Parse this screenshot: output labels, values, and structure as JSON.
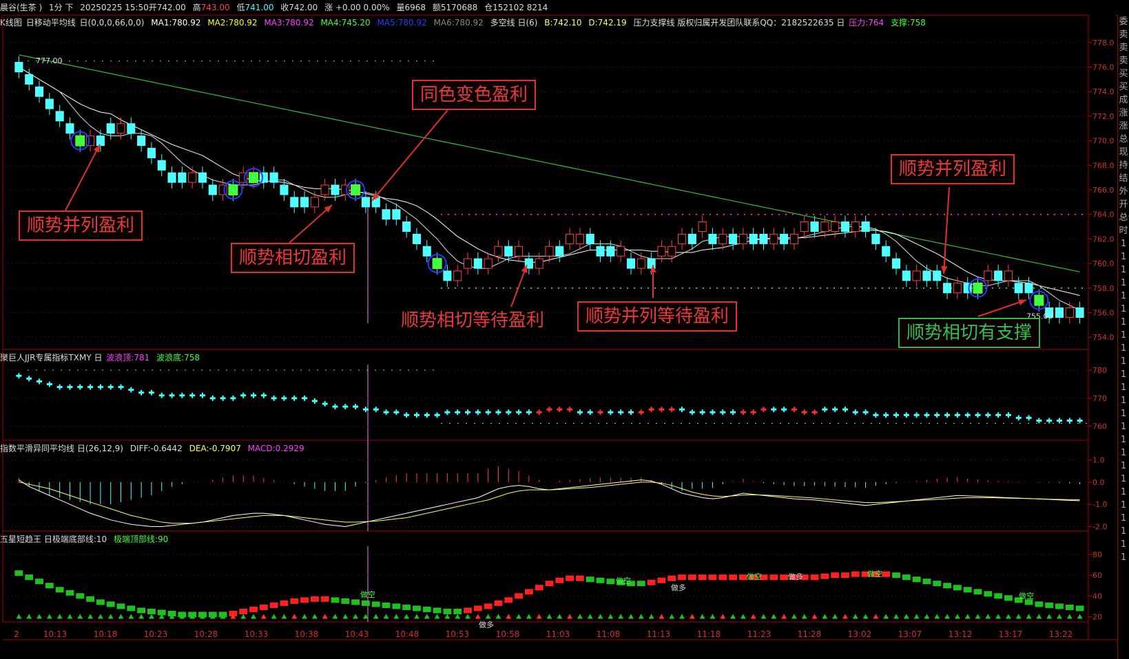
{
  "header": {
    "instrument": "晨谷(生茶 )",
    "period": "1分 下",
    "date": "20250225 15:50",
    "open_label": "开742.00",
    "high_label": "高",
    "high": "743.00",
    "low_label": "低",
    "low": "741.00",
    "close_label": "收742.00",
    "change_label": "涨 +0.00 0.00%",
    "volume": "量6968",
    "amount": "额5170688",
    "position": "仓152102 8214"
  },
  "main_legend": {
    "name": "K线图",
    "ma_name": "日移动平均线",
    "ma_params": "日(0,0,0,66,0,0)",
    "ma1": "MA1:780.92",
    "ma2": "MA2:780.92",
    "ma3": "MA3:780.92",
    "ma4": "MA4:745.20",
    "ma5": "MA5:780.92",
    "ma6": "MA6:780.92",
    "dk": "多空线 日(6)",
    "b": "B:742.10",
    "d": "D:742.19",
    "pressure_name": "压力支撑线 版权归属开发团队联系QQ：2182522635 日",
    "pressure": "压力:764",
    "support": "支撑:758",
    "colors": {
      "ma1": "#ffffff",
      "ma2": "#ffff00",
      "ma3": "#ff00ff",
      "ma4": "#00ff00",
      "ma5": "#2040ff",
      "ma6": "#888888"
    }
  },
  "annotations": [
    {
      "text": "同色变色盈利",
      "style": "red"
    },
    {
      "text": "顺势并列盈利",
      "style": "red"
    },
    {
      "text": "顺势相切盈利",
      "style": "red"
    },
    {
      "text": "顺势相切等待盈利",
      "style": "red"
    },
    {
      "text": "顺势并列等待盈利",
      "style": "red"
    },
    {
      "text": "顺势并列盈利",
      "style": "red"
    },
    {
      "text": "顺势相切有支撑",
      "style": "green"
    }
  ],
  "price_labels": {
    "high_marker": "777.00",
    "low_marker": "755.00"
  },
  "panel2_legend": {
    "name": "聚巨人JJR专属指标TXMY 日",
    "top": "波浪顶:781",
    "bottom": "波浪底:758"
  },
  "panel3_legend": {
    "name": "指数平滑异同平均线 日(26,12,9)",
    "diff": "DIFF:-0.6442",
    "dea": "DEA:-0.7907",
    "macd": "MACD:0.2929"
  },
  "panel4_legend": {
    "name": "五星短趋王 日极端底部线:10",
    "top": "极端顶部线:90"
  },
  "panel4_labels": [
    "做空",
    "做多",
    "做空",
    "做多",
    "做空",
    "做多",
    "做空",
    "做空"
  ],
  "right_column_text": [
    "委",
    "卖",
    "卖",
    "卖",
    "买",
    "买",
    "成",
    "涨",
    "涨",
    "总",
    "现",
    "持",
    "结",
    "外",
    "开",
    "总",
    "时",
    "1",
    "1",
    "1",
    "1",
    "1",
    "1",
    "1",
    "1",
    "1",
    "1",
    "1",
    "1",
    "1",
    "1",
    "1",
    "1",
    "1",
    "1",
    "1",
    "1",
    "1",
    "1",
    "1",
    "1",
    "1"
  ],
  "x_axis": [
    "2",
    "10:13",
    "10:18",
    "10:23",
    "10:28",
    "10:33",
    "10:38",
    "10:43",
    "10:48",
    "10:53",
    "10:58",
    "11:03",
    "11:08",
    "11:13",
    "11:18",
    "11:23",
    "11:28",
    "13:02",
    "13:07",
    "13:12",
    "13:17",
    "13:22"
  ],
  "chart_data": [
    {
      "type": "candlestick",
      "title": "K线图",
      "ylim": [
        753,
        779
      ],
      "y_ticks": [
        "778.0",
        "776.0",
        "774.0",
        "772.0",
        "770.0",
        "768.0",
        "766.0",
        "764.0",
        "762.0",
        "760.0",
        "758.0",
        "756.0",
        "754.0"
      ],
      "close": [
        776,
        775,
        774,
        773,
        772,
        771,
        770,
        770,
        770,
        771,
        771,
        771,
        770,
        769,
        768,
        767,
        767,
        767,
        767,
        766,
        766,
        766,
        767,
        767,
        767,
        767,
        766,
        765,
        765,
        765,
        766,
        766,
        766,
        766,
        765,
        765,
        764,
        764,
        763,
        762,
        761,
        760,
        759,
        759,
        760,
        760,
        760,
        761,
        761,
        761,
        760,
        760,
        761,
        761,
        762,
        762,
        762,
        761,
        761,
        761,
        760,
        760,
        760,
        761,
        761,
        762,
        762,
        763,
        762,
        762,
        762,
        762,
        762,
        762,
        762,
        762,
        762,
        763,
        763,
        763,
        763,
        763,
        763,
        763,
        762,
        761,
        760,
        759,
        759,
        759,
        759,
        758,
        758,
        758,
        758,
        759,
        759,
        759,
        758,
        758,
        757,
        756,
        756,
        756,
        756
      ],
      "direction": [
        0,
        0,
        0,
        0,
        0,
        0,
        0,
        1,
        0,
        0,
        1,
        0,
        0,
        0,
        0,
        0,
        0,
        1,
        0,
        0,
        1,
        0,
        1,
        1,
        0,
        0,
        0,
        0,
        0,
        1,
        1,
        0,
        1,
        0,
        0,
        0,
        0,
        0,
        0,
        0,
        0,
        0,
        0,
        1,
        1,
        0,
        1,
        1,
        0,
        1,
        0,
        1,
        1,
        0,
        1,
        1,
        0,
        0,
        0,
        1,
        0,
        1,
        0,
        1,
        1,
        1,
        0,
        1,
        0,
        1,
        0,
        1,
        0,
        0,
        1,
        0,
        1,
        1,
        0,
        1,
        1,
        0,
        1,
        0,
        0,
        0,
        0,
        0,
        1,
        0,
        0,
        0,
        1,
        0,
        0,
        1,
        0,
        1,
        0,
        0,
        0,
        0,
        0,
        1,
        0
      ],
      "highlights": [
        6,
        21,
        23,
        33,
        41,
        94,
        100
      ],
      "support": 758,
      "pressure": 764
    },
    {
      "type": "scatter",
      "title": "聚巨人JJR专属指标TXMY",
      "ylim": [
        755,
        782
      ],
      "y_ticks": [
        "780",
        "770",
        "760"
      ],
      "values": [
        778,
        777,
        776,
        775,
        774,
        774,
        774,
        774,
        774,
        774,
        774,
        773,
        772,
        772,
        771,
        771,
        771,
        771,
        771,
        770,
        770,
        770,
        771,
        771,
        771,
        770,
        770,
        770,
        770,
        769,
        768,
        767,
        767,
        767,
        766,
        766,
        765,
        765,
        764,
        764,
        764,
        764,
        765,
        765,
        765,
        765,
        765,
        765,
        765,
        765,
        765,
        765,
        766,
        766,
        766,
        765,
        765,
        765,
        765,
        765,
        765,
        765,
        766,
        766,
        766,
        766,
        765,
        765,
        765,
        765,
        765,
        765,
        765,
        766,
        766,
        766,
        766,
        765,
        765,
        766,
        766,
        766,
        765,
        765,
        764,
        764,
        764,
        764,
        764,
        764,
        764,
        764,
        764,
        764,
        764,
        764,
        764,
        764,
        763,
        763,
        762,
        762,
        762,
        762,
        762
      ],
      "up_marks": [
        51,
        52,
        53,
        54,
        57,
        61,
        62,
        63,
        64,
        71,
        72,
        73,
        76,
        77,
        78
      ]
    },
    {
      "type": "line",
      "title": "指数平滑异同平均线",
      "ylim": [
        -2.2,
        1.2
      ],
      "y_ticks": [
        "1.0",
        "0.0",
        "-1.0",
        "-2.0"
      ],
      "series": [
        {
          "name": "DIFF",
          "values": [
            0.1,
            -0.2,
            -0.4,
            -0.6,
            -0.8,
            -1.0,
            -1.2,
            -1.4,
            -1.55,
            -1.7,
            -1.8,
            -1.9,
            -1.95,
            -2.0,
            -2.0,
            -1.95,
            -1.9,
            -1.85,
            -1.8,
            -1.7,
            -1.6,
            -1.5,
            -1.45,
            -1.4,
            -1.4,
            -1.45,
            -1.5,
            -1.6,
            -1.7,
            -1.8,
            -1.9,
            -1.95,
            -2.0,
            -1.9,
            -1.8,
            -1.7,
            -1.6,
            -1.5,
            -1.4,
            -1.3,
            -1.2,
            -1.1,
            -1.0,
            -0.9,
            -0.8,
            -0.7,
            -0.5,
            -0.3,
            -0.2,
            -0.15,
            -0.2,
            -0.3,
            -0.35,
            -0.3,
            -0.25,
            -0.2,
            -0.15,
            -0.1,
            -0.05,
            0.0,
            0.05,
            0.1,
            0.05,
            -0.1,
            -0.3,
            -0.5,
            -0.6,
            -0.7,
            -0.75,
            -0.7,
            -0.6,
            -0.5,
            -0.55,
            -0.6,
            -0.65,
            -0.7,
            -0.75,
            -0.78,
            -0.8,
            -0.85,
            -0.9,
            -0.95,
            -1.0,
            -1.05,
            -1.0,
            -0.95,
            -0.9,
            -0.85,
            -0.8,
            -0.75,
            -0.7,
            -0.65,
            -0.6,
            -0.62,
            -0.64,
            -0.66,
            -0.68,
            -0.7,
            -0.72,
            -0.74,
            -0.76,
            -0.78,
            -0.8,
            -0.82,
            -0.84
          ]
        },
        {
          "name": "DEA",
          "values": [
            0.0,
            -0.1,
            -0.2,
            -0.3,
            -0.45,
            -0.6,
            -0.75,
            -0.9,
            -1.05,
            -1.2,
            -1.35,
            -1.5,
            -1.6,
            -1.7,
            -1.8,
            -1.85,
            -1.85,
            -1.85,
            -1.8,
            -1.75,
            -1.7,
            -1.65,
            -1.6,
            -1.55,
            -1.5,
            -1.5,
            -1.5,
            -1.55,
            -1.6,
            -1.65,
            -1.7,
            -1.75,
            -1.8,
            -1.8,
            -1.78,
            -1.75,
            -1.7,
            -1.65,
            -1.6,
            -1.5,
            -1.4,
            -1.3,
            -1.2,
            -1.1,
            -1.0,
            -0.9,
            -0.8,
            -0.65,
            -0.5,
            -0.4,
            -0.35,
            -0.35,
            -0.35,
            -0.33,
            -0.3,
            -0.27,
            -0.24,
            -0.2,
            -0.15,
            -0.1,
            -0.05,
            0.0,
            0.0,
            -0.05,
            -0.15,
            -0.3,
            -0.45,
            -0.55,
            -0.62,
            -0.65,
            -0.62,
            -0.58,
            -0.57,
            -0.58,
            -0.6,
            -0.63,
            -0.66,
            -0.69,
            -0.72,
            -0.76,
            -0.8,
            -0.84,
            -0.88,
            -0.92,
            -0.92,
            -0.9,
            -0.88,
            -0.85,
            -0.82,
            -0.8,
            -0.78,
            -0.75,
            -0.72,
            -0.7,
            -0.7,
            -0.7,
            -0.71,
            -0.72,
            -0.73,
            -0.74,
            -0.75,
            -0.77,
            -0.78,
            -0.79,
            -0.79
          ]
        }
      ]
    },
    {
      "type": "bar",
      "title": "五星短趋王",
      "ylim": [
        15,
        88
      ],
      "y_ticks": [
        "80",
        "60",
        "40",
        "20"
      ],
      "values": [
        62,
        58,
        54,
        50,
        46,
        43,
        40,
        37,
        34,
        32,
        30,
        28,
        26,
        25,
        24,
        23,
        22,
        22,
        22,
        22,
        22,
        23,
        25,
        27,
        29,
        31,
        33,
        35,
        36,
        37,
        37,
        36,
        35,
        34,
        33,
        32,
        31,
        30,
        29,
        28,
        27,
        26,
        25,
        25,
        26,
        28,
        30,
        33,
        36,
        40,
        44,
        48,
        52,
        55,
        57,
        57,
        56,
        55,
        54,
        53,
        52,
        52,
        53,
        55,
        57,
        58,
        58,
        58,
        58,
        58,
        58,
        58,
        58,
        58,
        58,
        58,
        58,
        58,
        58,
        59,
        60,
        60,
        61,
        61,
        61,
        61,
        60,
        58,
        56,
        54,
        52,
        50,
        48,
        46,
        44,
        42,
        40,
        38,
        36,
        34,
        32,
        31,
        30,
        29,
        28
      ],
      "direction": [
        0,
        0,
        0,
        0,
        0,
        0,
        0,
        0,
        0,
        0,
        0,
        0,
        0,
        0,
        0,
        0,
        0,
        0,
        0,
        0,
        0,
        1,
        1,
        1,
        1,
        1,
        1,
        1,
        1,
        1,
        1,
        0,
        0,
        0,
        0,
        0,
        0,
        0,
        0,
        0,
        0,
        0,
        0,
        0,
        1,
        1,
        1,
        1,
        1,
        1,
        1,
        1,
        1,
        1,
        1,
        1,
        0,
        0,
        0,
        0,
        0,
        0,
        1,
        1,
        1,
        1,
        1,
        1,
        1,
        1,
        1,
        1,
        1,
        1,
        1,
        1,
        1,
        1,
        1,
        1,
        1,
        1,
        1,
        1,
        1,
        1,
        0,
        0,
        0,
        0,
        0,
        0,
        0,
        0,
        0,
        0,
        0,
        0,
        0,
        0,
        0,
        0,
        0,
        0,
        0
      ]
    }
  ]
}
